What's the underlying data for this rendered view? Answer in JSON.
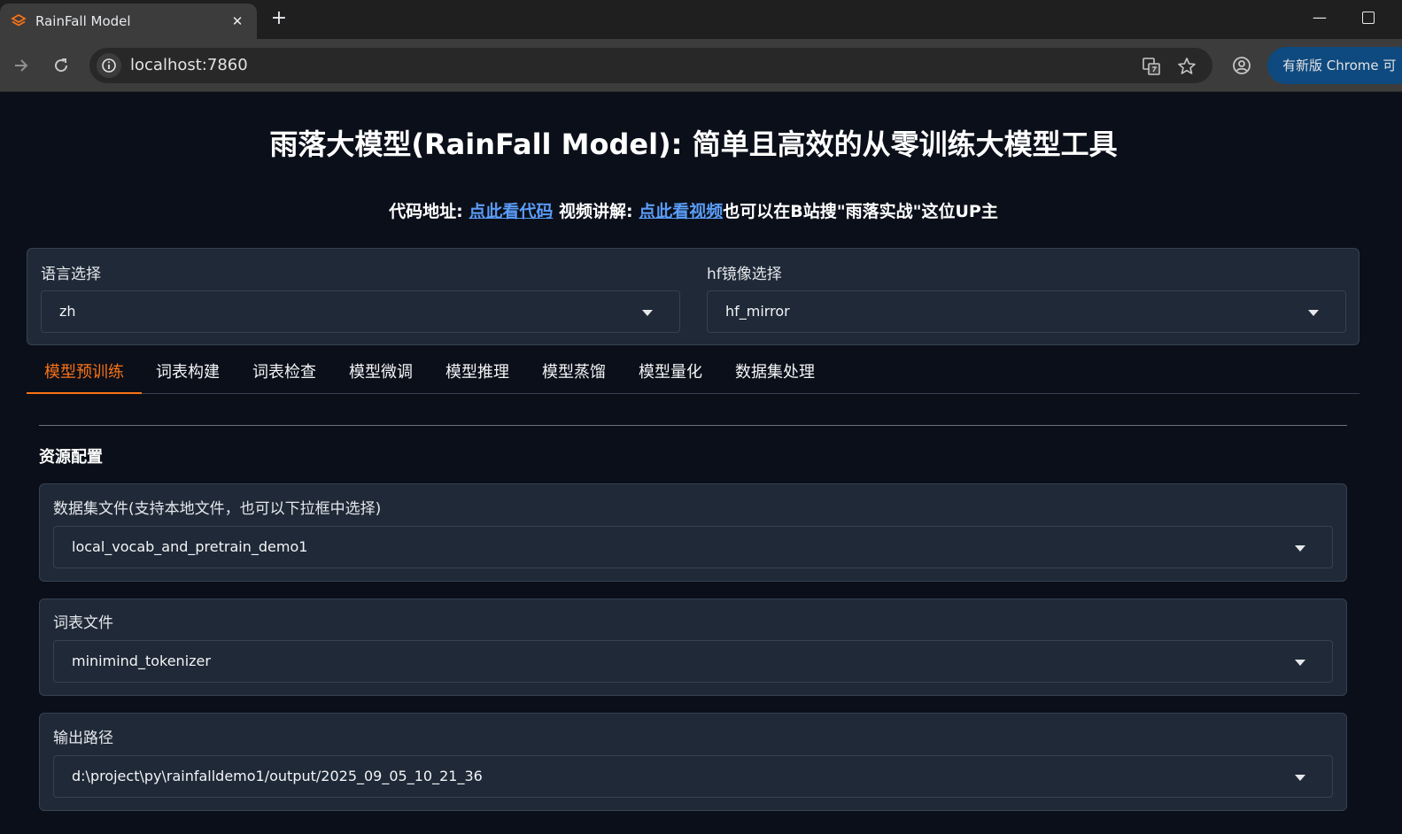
{
  "browser": {
    "tab_title": "RainFall Model",
    "tab_close": "✕",
    "new_tab": "+",
    "url": "localhost:7860",
    "update_button": "有新版 Chrome 可",
    "minimize": "—"
  },
  "header": {
    "title": "雨落大模型(RainFall Model): 简单且高效的从零训练大模型工具",
    "code_prefix": "代码地址: ",
    "code_link": "点此看代码",
    "video_prefix": " 视频讲解: ",
    "video_link": "点此看视频",
    "suffix": "也可以在B站搜\"雨落实战\"这位UP主"
  },
  "settings": {
    "language_label": "语言选择",
    "language_value": "zh",
    "mirror_label": "hf镜像选择",
    "mirror_value": "hf_mirror"
  },
  "tabs": [
    "模型预训练",
    "词表构建",
    "词表检查",
    "模型微调",
    "模型推理",
    "模型蒸馏",
    "模型量化",
    "数据集处理"
  ],
  "active_tab": "模型预训练",
  "resources": {
    "section_title": "资源配置",
    "dataset_label": "数据集文件(支持本地文件，也可以下拉框中选择)",
    "dataset_value": "local_vocab_and_pretrain_demo1",
    "vocab_label": "词表文件",
    "vocab_value": "minimind_tokenizer",
    "output_label": "输出路径",
    "output_value": "d:\\project\\py\\rainfalldemo1/output/2025_09_05_10_21_36"
  },
  "colors": {
    "accent": "#f97316",
    "link": "#5a9cf8",
    "page_bg": "#0b0f19",
    "panel_bg": "#1f2937"
  }
}
